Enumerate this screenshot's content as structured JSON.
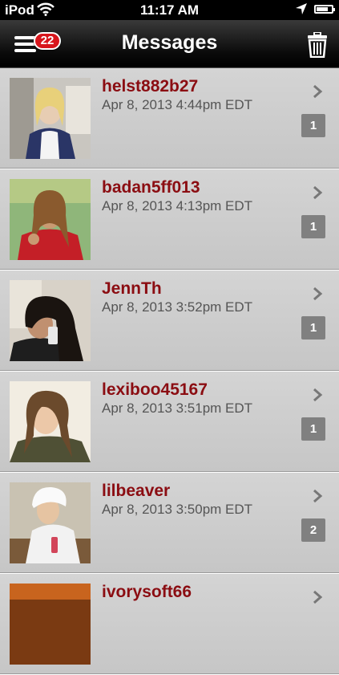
{
  "status_bar": {
    "carrier": "iPod",
    "time": "11:17 AM"
  },
  "nav": {
    "title": "Messages",
    "badge_count": "22"
  },
  "messages": [
    {
      "name": "helst882b27",
      "date": "Apr 8, 2013 4:44pm EDT",
      "count": "1"
    },
    {
      "name": "badan5ff013",
      "date": "Apr 8, 2013 4:13pm EDT",
      "count": "1"
    },
    {
      "name": "JennTh",
      "date": "Apr 8, 2013 3:52pm EDT",
      "count": "1"
    },
    {
      "name": "lexiboo45167",
      "date": "Apr 8, 2013 3:51pm EDT",
      "count": "1"
    },
    {
      "name": "lilbeaver",
      "date": "Apr 8, 2013 3:50pm EDT",
      "count": "2"
    },
    {
      "name": "ivorysoft66",
      "date": "",
      "count": ""
    }
  ],
  "colors": {
    "name": "#8b0d12",
    "badge": "#d8161c",
    "count_box": "#808080"
  }
}
